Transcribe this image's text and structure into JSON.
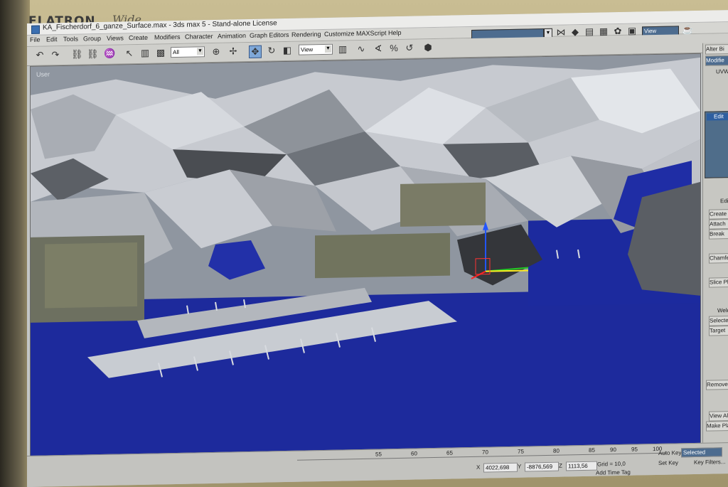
{
  "monitor": {
    "brand": "FLATRON",
    "model": "Wide"
  },
  "window": {
    "title": "KA_Fischerdorf_6_ganze_Surface.max - 3ds max 5 - Stand-alone License"
  },
  "menu": [
    "File",
    "Edit",
    "Tools",
    "Group",
    "Views",
    "Create",
    "Modifiers",
    "Character",
    "Animation",
    "Graph Editors",
    "Rendering",
    "Customize",
    "MAXScript",
    "Help"
  ],
  "toolbar": {
    "selection_filter": "All",
    "ref_coord_upper": "View",
    "ref_coord": "View"
  },
  "viewport": {
    "label": "User"
  },
  "command_panel": {
    "top_label": "Alter Bi",
    "modifier_list": "Modifie",
    "uvw": "UVW",
    "stack_item": "Edit",
    "edit_label": "Edit",
    "create": "Create",
    "attach": "Attach",
    "break": "Break",
    "chamfer": "Chamfer",
    "slice_plane": "Slice Plane",
    "weld": "Weld",
    "selected": "Selected",
    "target": "Target",
    "remove_isolated": "Remove Isolated",
    "view_align": "View Align",
    "grid": "Gri",
    "make_planar": "Make Planar",
    "col": "Co"
  },
  "status": {
    "x": "4022,698",
    "y": "-8876,569",
    "z": "1113,56",
    "grid": "Grid = 10,0",
    "add_time_tag": "Add Time Tag",
    "auto_key": "Auto Key",
    "set_key": "Set Key",
    "key_filters": "Key Filters...",
    "selected": "Selected",
    "timeline_ticks": [
      "55",
      "60",
      "65",
      "70",
      "75",
      "80",
      "85",
      "90",
      "95",
      "100"
    ]
  },
  "colors": {
    "water": "#1d2a9c",
    "mesh_light": "#c9ccd2",
    "mesh_dark": "#3a3c40",
    "ui_gray": "#cfcfcb"
  }
}
